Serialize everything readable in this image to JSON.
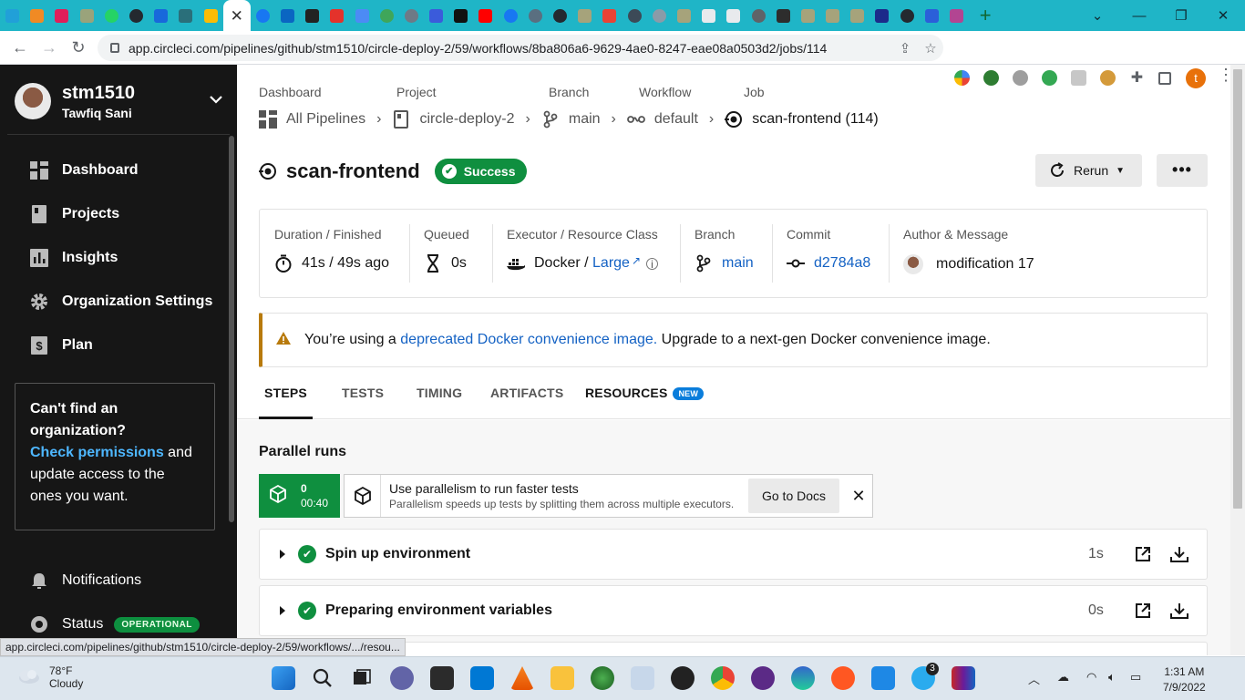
{
  "browser": {
    "active_tab_close": "✕",
    "new_tab": "+",
    "url": "app.circleci.com/pipelines/github/stm1510/circle-deploy-2/59/workflows/8ba806a6-9629-4ae0-8247-eae08a0503d2/jobs/114",
    "status_url": "app.circleci.com/pipelines/github/stm1510/circle-deploy-2/59/workflows/.../resou...",
    "profile_initial": "t"
  },
  "sidebar": {
    "username": "stm1510",
    "fullname": "Tawfiq Sani",
    "items": [
      {
        "label": "Dashboard",
        "icon": "dashboard-icon"
      },
      {
        "label": "Projects",
        "icon": "projects-icon"
      },
      {
        "label": "Insights",
        "icon": "insights-icon"
      },
      {
        "label": "Organization Settings",
        "icon": "gear-icon"
      },
      {
        "label": "Plan",
        "icon": "dollar-icon"
      }
    ],
    "callout": {
      "title": "Can't find an organization?",
      "link": "Check permissions",
      "rest": " and update access to the ones you want."
    },
    "notifications": "Notifications",
    "status": "Status",
    "status_badge": "OPERATIONAL"
  },
  "breadcrumb": {
    "labels": [
      "Dashboard",
      "Project",
      "Branch",
      "Workflow",
      "Job"
    ],
    "values": [
      "All Pipelines",
      "circle-deploy-2",
      "main",
      "default",
      "scan-frontend (114)"
    ]
  },
  "job": {
    "name": "scan-frontend",
    "status": "Success",
    "rerun": "Rerun",
    "more": "•••"
  },
  "info": {
    "duration_label": "Duration / Finished",
    "duration_value": "41s / 49s ago",
    "queued_label": "Queued",
    "queued_value": "0s",
    "executor_label": "Executor / Resource Class",
    "executor_value": "Docker",
    "executor_sep": " / ",
    "resource_class": "Large",
    "branch_label": "Branch",
    "branch_value": "main",
    "commit_label": "Commit",
    "commit_value": "d2784a8",
    "author_label": "Author & Message",
    "message": "modification 17"
  },
  "warning": {
    "prefix": "You’re using a ",
    "link": "deprecated Docker convenience image.",
    "suffix": " Upgrade to a next-gen Docker convenience image."
  },
  "tabs": [
    "STEPS",
    "TESTS",
    "TIMING",
    "ARTIFACTS",
    "RESOURCES"
  ],
  "tab_new_badge": "NEW",
  "parallel": {
    "title": "Parallel runs",
    "run_index": "0",
    "run_time": "00:40",
    "promo_title": "Use parallelism to run faster tests",
    "promo_sub": "Parallelism speeds up tests by splitting them across multiple executors.",
    "docs_button": "Go to Docs"
  },
  "steps": [
    {
      "name": "Spin up environment",
      "duration": "1s"
    },
    {
      "name": "Preparing environment variables",
      "duration": "0s"
    }
  ],
  "taskbar": {
    "temp": "78°F",
    "weather": "Cloudy",
    "time": "1:31 AM",
    "date": "7/9/2022",
    "telegram_badge": "3"
  },
  "colors": {
    "tabbar": "#1fb5c7",
    "sidebar": "#161616",
    "success": "#0f8f3f",
    "link": "#1462c4",
    "warning": "#b87a0c"
  }
}
